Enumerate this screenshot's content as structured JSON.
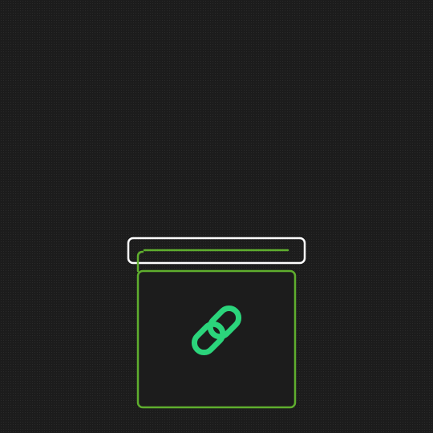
{
  "illustration": {
    "description_icon": "chain-link-icon",
    "colors": {
      "background": "#1c1c1c",
      "slot_outline": "#ffffff",
      "card_outline": "#5fae2e",
      "link_icon": "#2bd47b"
    }
  }
}
